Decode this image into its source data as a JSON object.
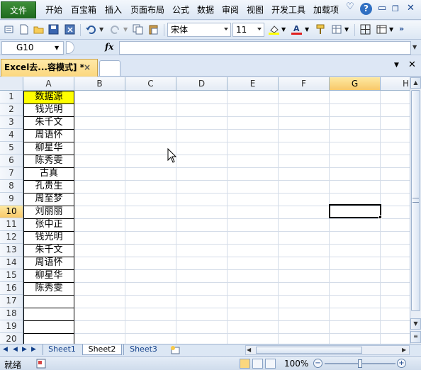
{
  "menu": {
    "file": "文件",
    "items": [
      "开始",
      "百宝箱",
      "插入",
      "页面布局",
      "公式",
      "数据",
      "审阅",
      "视图",
      "开发工具",
      "加载项"
    ]
  },
  "toolbar": {
    "font_name": "宋体",
    "font_size": "11"
  },
  "formula_bar": {
    "name_box": "G10",
    "fx": "fx",
    "value": ""
  },
  "doc_tab": {
    "title": "Excel去...容模式] *",
    "close": "×"
  },
  "grid": {
    "columns": [
      "A",
      "B",
      "C",
      "D",
      "E",
      "F",
      "G",
      "H"
    ],
    "rows": [
      "1",
      "2",
      "3",
      "4",
      "5",
      "6",
      "7",
      "8",
      "9",
      "10",
      "11",
      "12",
      "13",
      "14",
      "15",
      "16",
      "17",
      "18",
      "19",
      "20"
    ],
    "selected_column": "G",
    "selected_row": "10",
    "column_a": [
      "数据源",
      "钱光明",
      "朱千文",
      "周语怀",
      "柳星华",
      "陈秀雯",
      "古真",
      "孔贵生",
      "周至梦",
      "刘丽丽",
      "张中正",
      "钱光明",
      "朱千文",
      "周语怀",
      "柳星华",
      "陈秀雯",
      "",
      "",
      "",
      ""
    ],
    "header_fill": "#ffff00"
  },
  "sheets": {
    "tabs": [
      "Sheet1",
      "Sheet2",
      "Sheet3"
    ],
    "active": "Sheet2"
  },
  "status": {
    "text": "就绪",
    "zoom": "100%"
  },
  "colors": {
    "file_button": "#2a7d2a",
    "selection_header": "#f8c869",
    "chrome": "#dce7f4"
  }
}
